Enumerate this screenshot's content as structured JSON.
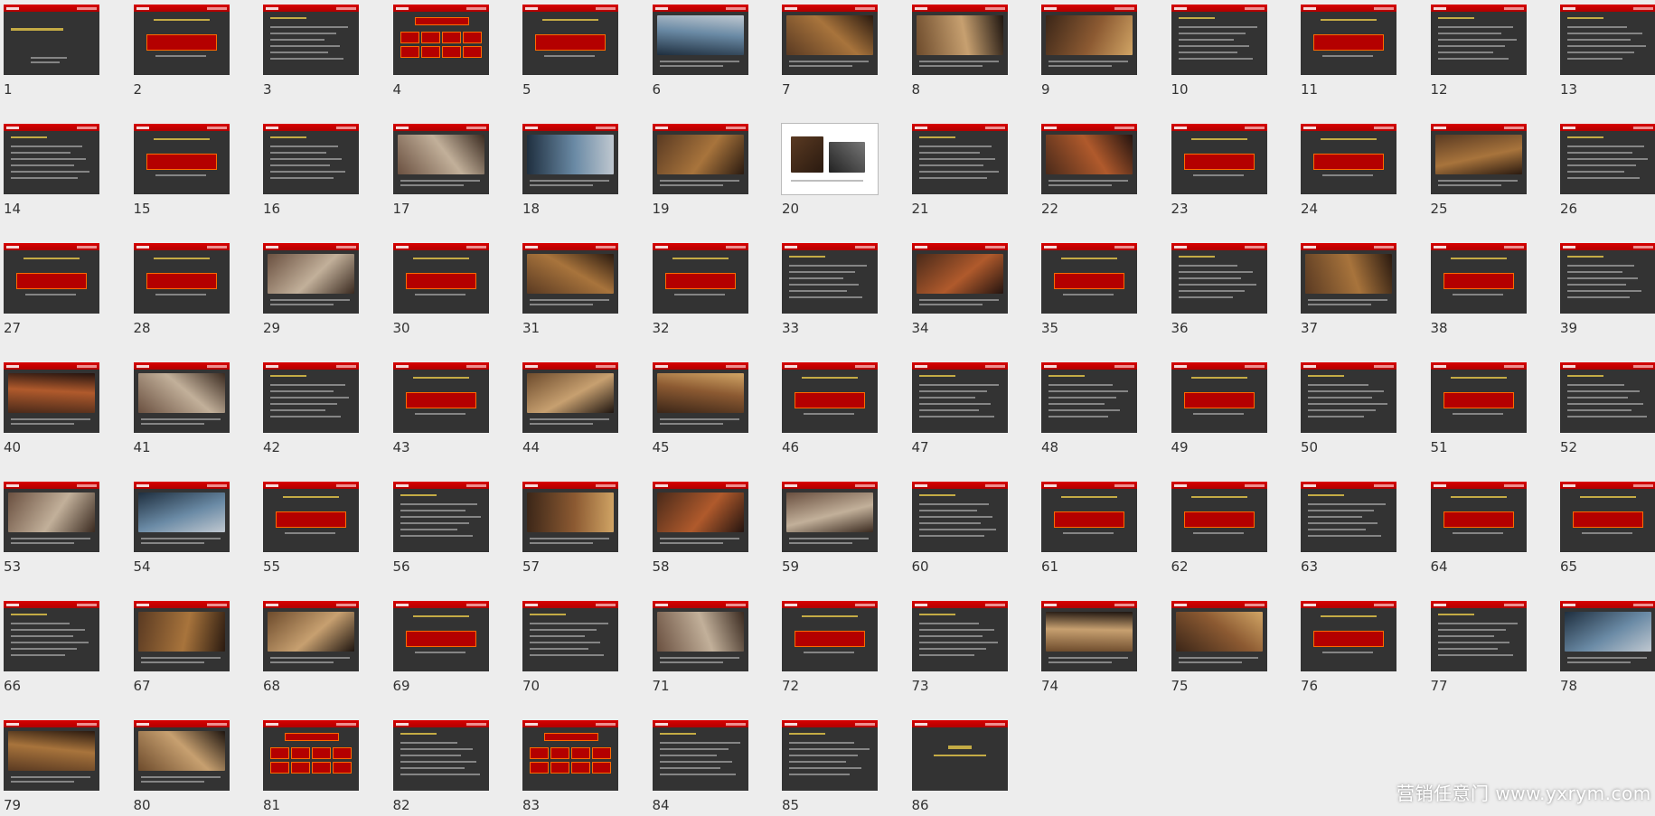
{
  "watermark": "营销任意门 www.yxrym.com",
  "slides": [
    {
      "n": "1",
      "t": "t"
    },
    {
      "n": "2",
      "t": "r"
    },
    {
      "n": "3",
      "t": "x"
    },
    {
      "n": "4",
      "t": "g"
    },
    {
      "n": "5",
      "t": "r"
    },
    {
      "n": "6",
      "t": "p"
    },
    {
      "n": "7",
      "t": "p"
    },
    {
      "n": "8",
      "t": "p"
    },
    {
      "n": "9",
      "t": "p"
    },
    {
      "n": "10",
      "t": "x"
    },
    {
      "n": "11",
      "t": "r"
    },
    {
      "n": "12",
      "t": "x"
    },
    {
      "n": "13",
      "t": "x"
    },
    {
      "n": "14",
      "t": "x"
    },
    {
      "n": "15",
      "t": "r"
    },
    {
      "n": "16",
      "t": "x"
    },
    {
      "n": "17",
      "t": "p"
    },
    {
      "n": "18",
      "t": "p"
    },
    {
      "n": "19",
      "t": "p"
    },
    {
      "n": "20",
      "t": "w"
    },
    {
      "n": "21",
      "t": "x"
    },
    {
      "n": "22",
      "t": "p"
    },
    {
      "n": "23",
      "t": "r"
    },
    {
      "n": "24",
      "t": "r"
    },
    {
      "n": "25",
      "t": "p"
    },
    {
      "n": "26",
      "t": "x"
    },
    {
      "n": "27",
      "t": "r"
    },
    {
      "n": "28",
      "t": "r"
    },
    {
      "n": "29",
      "t": "p"
    },
    {
      "n": "30",
      "t": "r"
    },
    {
      "n": "31",
      "t": "p"
    },
    {
      "n": "32",
      "t": "r"
    },
    {
      "n": "33",
      "t": "x"
    },
    {
      "n": "34",
      "t": "p"
    },
    {
      "n": "35",
      "t": "r"
    },
    {
      "n": "36",
      "t": "x"
    },
    {
      "n": "37",
      "t": "p"
    },
    {
      "n": "38",
      "t": "r"
    },
    {
      "n": "39",
      "t": "x"
    },
    {
      "n": "40",
      "t": "p"
    },
    {
      "n": "41",
      "t": "p"
    },
    {
      "n": "42",
      "t": "x"
    },
    {
      "n": "43",
      "t": "r"
    },
    {
      "n": "44",
      "t": "p"
    },
    {
      "n": "45",
      "t": "p"
    },
    {
      "n": "46",
      "t": "r"
    },
    {
      "n": "47",
      "t": "x"
    },
    {
      "n": "48",
      "t": "x"
    },
    {
      "n": "49",
      "t": "r"
    },
    {
      "n": "50",
      "t": "x"
    },
    {
      "n": "51",
      "t": "r"
    },
    {
      "n": "52",
      "t": "x"
    },
    {
      "n": "53",
      "t": "p"
    },
    {
      "n": "54",
      "t": "p"
    },
    {
      "n": "55",
      "t": "r"
    },
    {
      "n": "56",
      "t": "x"
    },
    {
      "n": "57",
      "t": "p"
    },
    {
      "n": "58",
      "t": "p"
    },
    {
      "n": "59",
      "t": "p"
    },
    {
      "n": "60",
      "t": "x"
    },
    {
      "n": "61",
      "t": "r"
    },
    {
      "n": "62",
      "t": "r"
    },
    {
      "n": "63",
      "t": "x"
    },
    {
      "n": "64",
      "t": "r"
    },
    {
      "n": "65",
      "t": "r"
    },
    {
      "n": "66",
      "t": "x"
    },
    {
      "n": "67",
      "t": "p"
    },
    {
      "n": "68",
      "t": "p"
    },
    {
      "n": "69",
      "t": "r"
    },
    {
      "n": "70",
      "t": "x"
    },
    {
      "n": "71",
      "t": "p"
    },
    {
      "n": "72",
      "t": "r"
    },
    {
      "n": "73",
      "t": "x"
    },
    {
      "n": "74",
      "t": "p"
    },
    {
      "n": "75",
      "t": "p"
    },
    {
      "n": "76",
      "t": "r"
    },
    {
      "n": "77",
      "t": "x"
    },
    {
      "n": "78",
      "t": "p"
    },
    {
      "n": "79",
      "t": "p"
    },
    {
      "n": "80",
      "t": "p"
    },
    {
      "n": "81",
      "t": "g"
    },
    {
      "n": "82",
      "t": "x"
    },
    {
      "n": "83",
      "t": "g"
    },
    {
      "n": "84",
      "t": "x"
    },
    {
      "n": "85",
      "t": "x"
    },
    {
      "n": "86",
      "t": "e"
    }
  ]
}
